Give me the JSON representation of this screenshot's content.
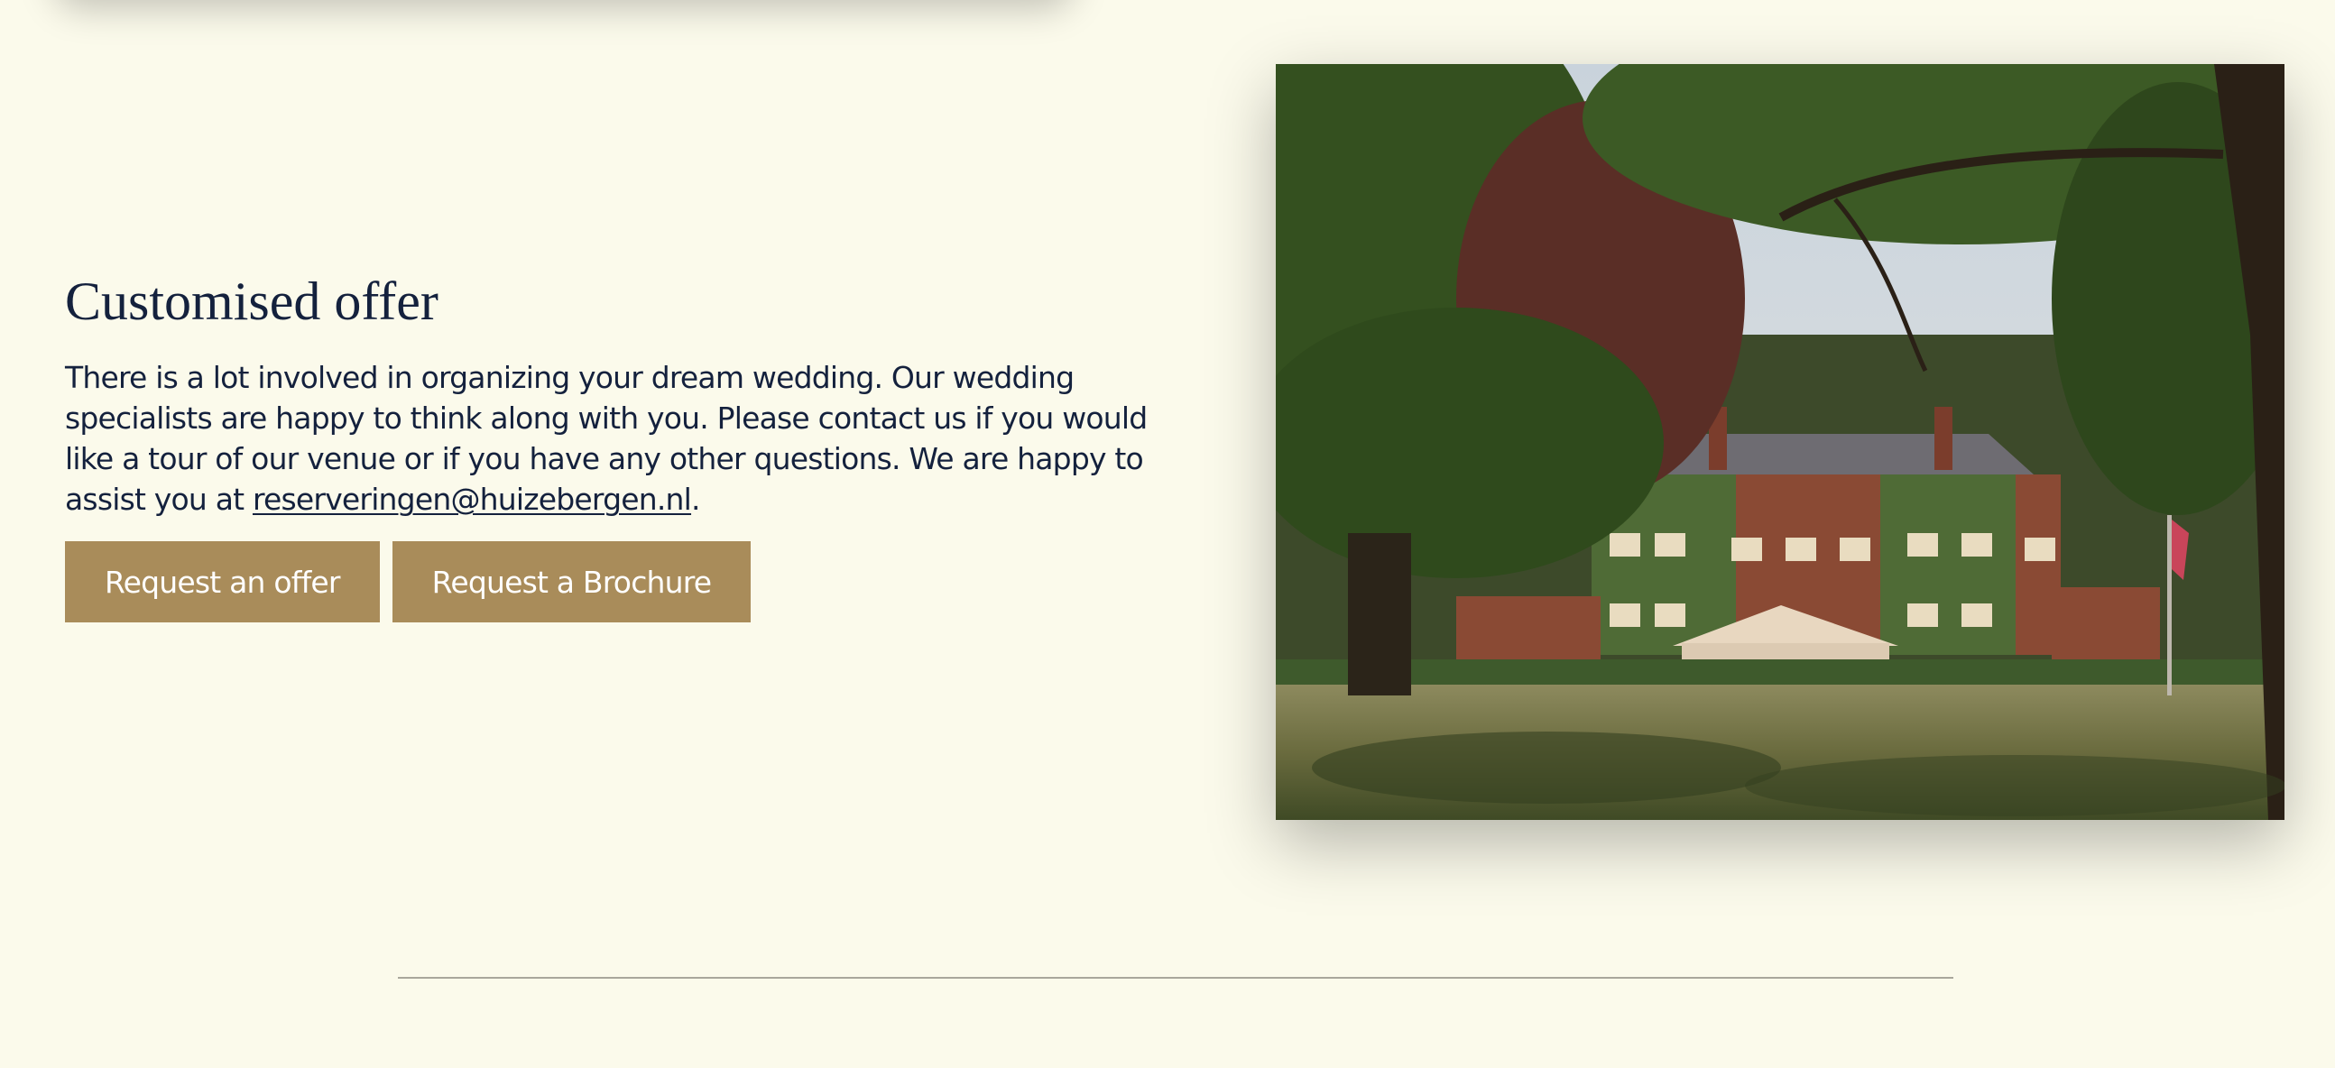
{
  "section": {
    "heading": "Customised offer",
    "body_text": "There is a lot involved in organizing your dream wedding. Our wedding specialists are happy to think along with you. Please contact us if you would like a tour of our venue or if you have any other questions. We are happy to assist you at ",
    "email": "reserveringen@huizebergen.nl",
    "email_href": "mailto:reserveringen@huizebergen.nl",
    "trailing": "."
  },
  "buttons": {
    "request_offer": "Request an offer",
    "request_brochure": "Request a Brochure"
  },
  "colors": {
    "background": "#fbfaeb",
    "text": "#14213d",
    "button": "#a98c5a",
    "divider": "#a9a79c"
  }
}
